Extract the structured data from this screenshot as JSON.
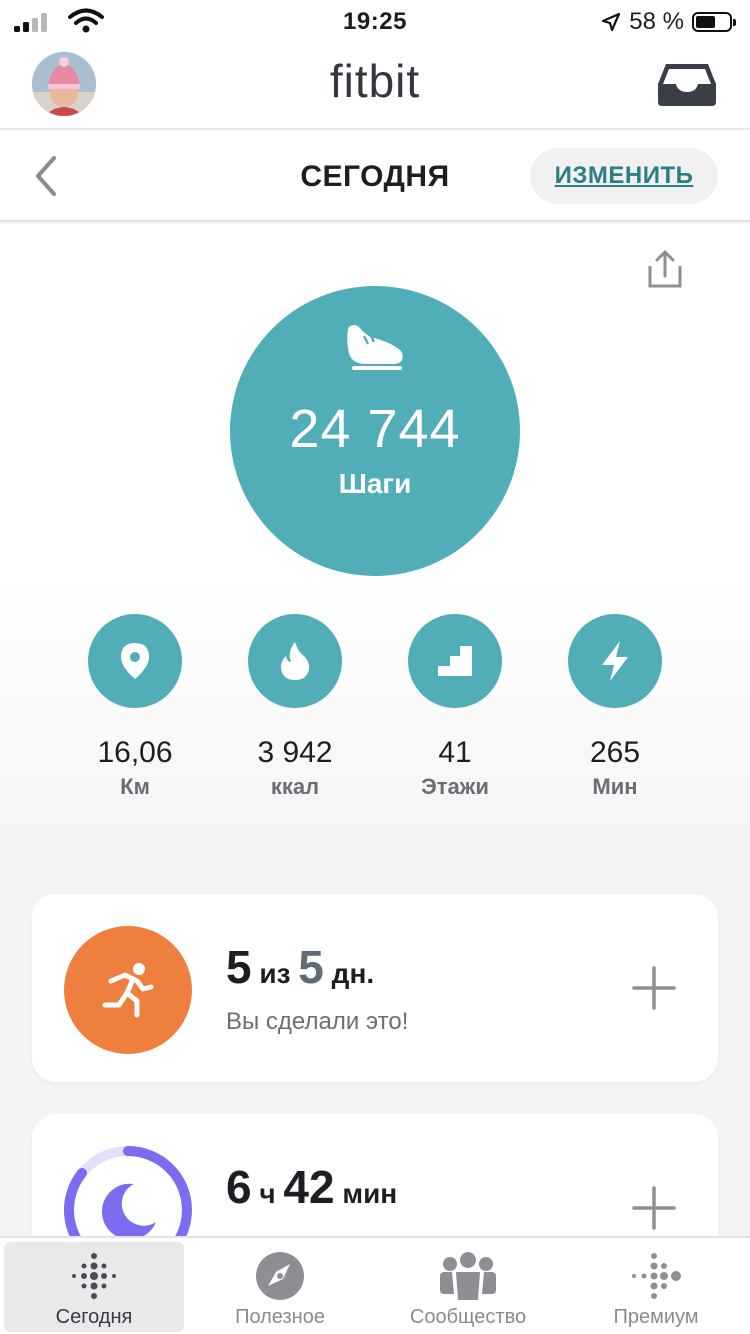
{
  "status_bar": {
    "time": "19:25",
    "battery_text": "58 %",
    "battery_level": 0.58
  },
  "header": {
    "logo": "fitbit"
  },
  "subheader": {
    "title": "СЕГОДНЯ",
    "edit_label": "ИЗМЕНИТЬ"
  },
  "steps": {
    "value": "24 744",
    "label": "Шаги"
  },
  "stats": [
    {
      "value": "16,06",
      "unit": "Км",
      "icon": "location-pin-icon"
    },
    {
      "value": "3 942",
      "unit": "ккал",
      "icon": "flame-icon"
    },
    {
      "value": "41",
      "unit": "Этажи",
      "icon": "stairs-icon"
    },
    {
      "value": "265",
      "unit": "Мин",
      "icon": "lightning-icon"
    }
  ],
  "exercise_card": {
    "done": "5",
    "of_word": "из",
    "goal": "5",
    "unit": "дн.",
    "message": "Вы сделали это!",
    "color": "#ef7f3f"
  },
  "sleep_card": {
    "hours": "6",
    "hours_unit": "ч",
    "minutes": "42",
    "minutes_unit": "мин",
    "color": "#7b6cf0"
  },
  "tabs": [
    {
      "label": "Сегодня",
      "icon": "today-dots-icon",
      "active": true
    },
    {
      "label": "Полезное",
      "icon": "compass-icon",
      "active": false
    },
    {
      "label": "Сообщество",
      "icon": "community-icon",
      "active": false
    },
    {
      "label": "Премиум",
      "icon": "premium-dots-icon",
      "active": false
    }
  ],
  "colors": {
    "accent": "#51aeb8",
    "link": "#2c7d86"
  }
}
